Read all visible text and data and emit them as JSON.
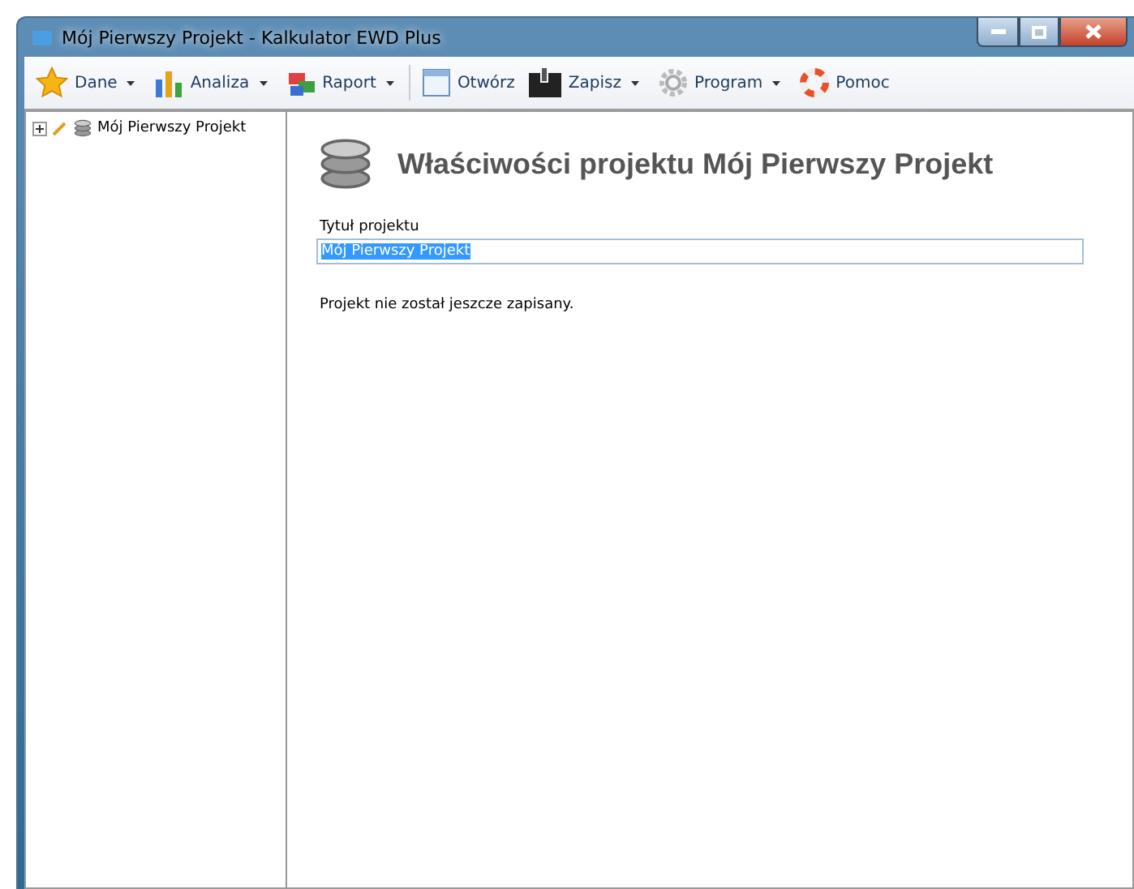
{
  "window": {
    "title": "Mój Pierwszy Projekt  - Kalkulator EWD Plus"
  },
  "toolbar": [
    {
      "label": "Dane",
      "dropdown": true,
      "separator_before": false
    },
    {
      "label": "Analiza",
      "dropdown": true,
      "separator_before": false
    },
    {
      "label": "Raport",
      "dropdown": true,
      "separator_before": false
    },
    {
      "label": "Otwórz",
      "dropdown": false,
      "separator_before": true
    },
    {
      "label": "Zapisz",
      "dropdown": true,
      "separator_before": false
    },
    {
      "label": "Program",
      "dropdown": true,
      "separator_before": false
    },
    {
      "label": "Pomoc",
      "dropdown": false,
      "separator_before": false
    }
  ],
  "tree": [
    {
      "label": "Mój Pierwszy Projekt",
      "expanded": false
    }
  ],
  "panel": {
    "heading": "Właściwości projektu Mój Pierwszy Projekt",
    "field_label": "Tytuł projektu",
    "field_value": "Mój Pierwszy Projekt",
    "value_selected": true,
    "status": "Projekt nie został jeszcze zapisany."
  }
}
